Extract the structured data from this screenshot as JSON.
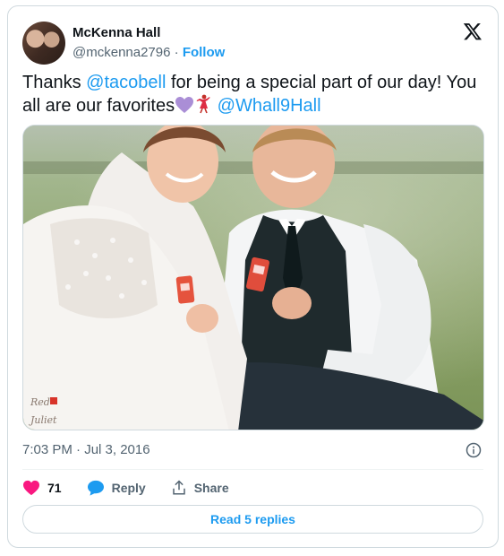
{
  "author": {
    "display_name": "McKenna Hall",
    "handle": "@mckenna2796",
    "separator": "·",
    "follow_label": "Follow"
  },
  "brand_icon": "x-logo-icon",
  "tweet": {
    "text_1": "Thanks ",
    "mention_1": "@tacobell",
    "text_2": " for being a special part of our day! You all are our favorites",
    "emoji_1": "purple-heart-icon",
    "emoji_2": "dancer-icon",
    "text_3": " ",
    "mention_2": "@Whall9Hall"
  },
  "photo": {
    "description_icon": "wedding-photo",
    "watermark": "Red Juliet"
  },
  "meta": {
    "timestamp": "7:03 PM · Jul 3, 2016"
  },
  "actions": {
    "like_count": "71",
    "reply_label": "Reply",
    "share_label": "Share"
  },
  "read_replies_label": "Read 5 replies",
  "colors": {
    "accent": "#1d9bf0",
    "like": "#f91880",
    "text": "#0f1419",
    "secondary": "#536471"
  }
}
